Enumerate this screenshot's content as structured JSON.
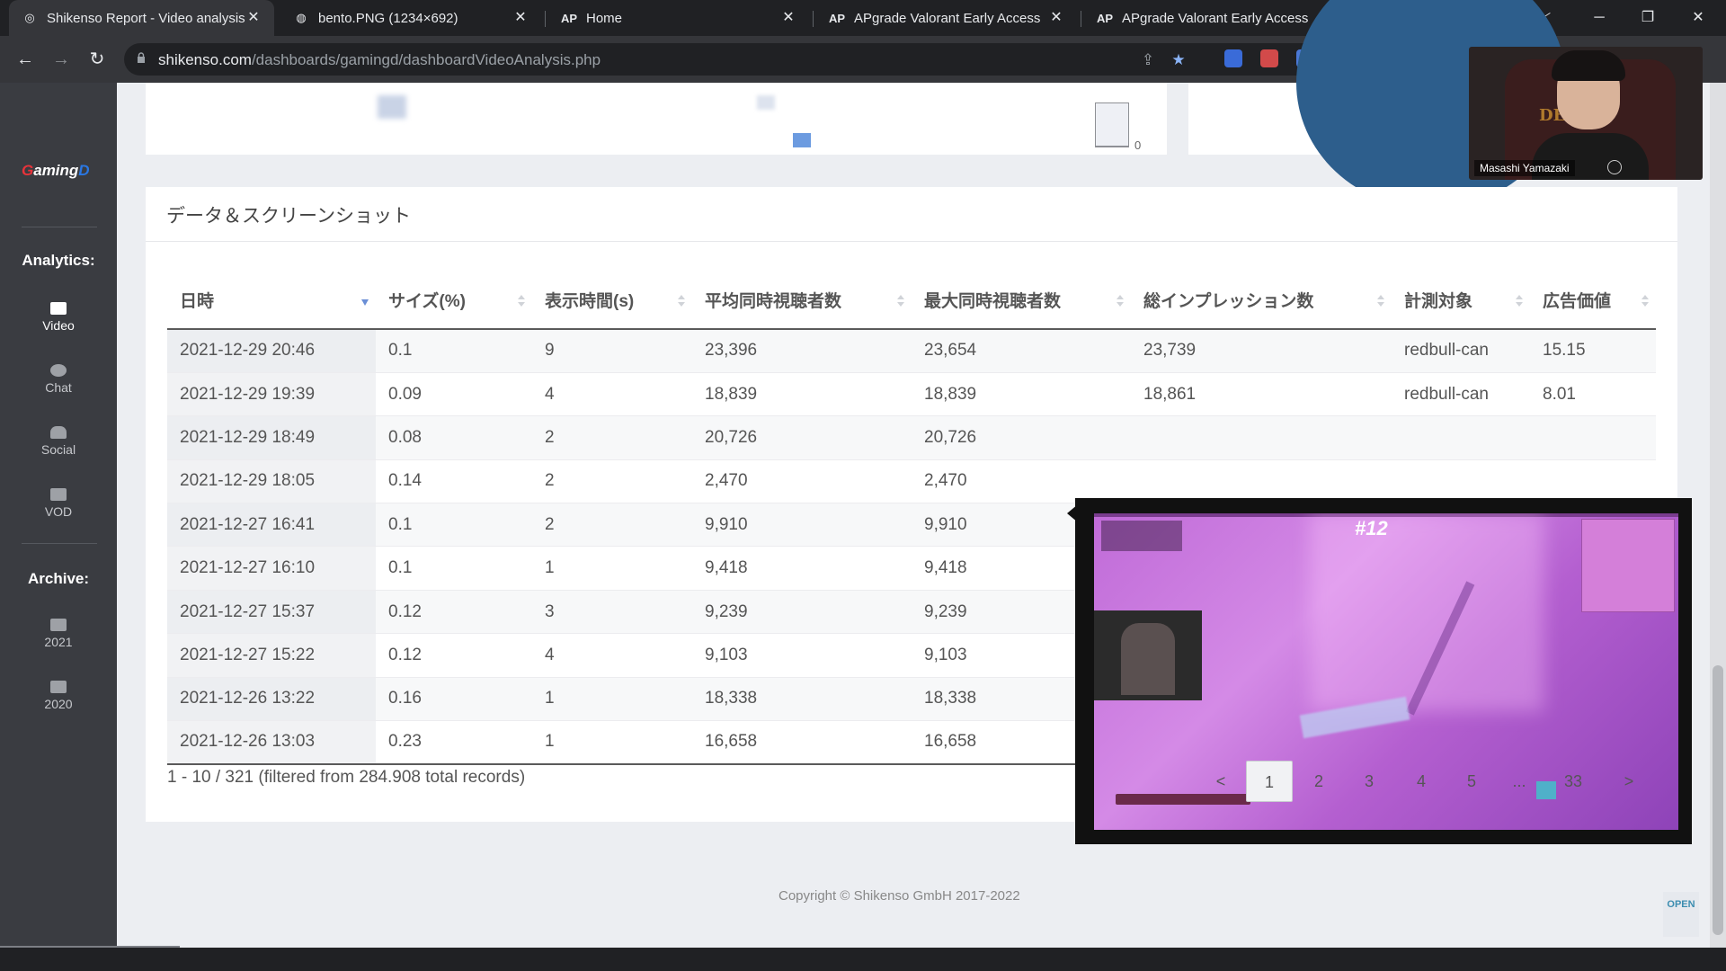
{
  "browser": {
    "tabs": [
      {
        "label": "Shikenso Report - Video analysis",
        "icon": "shikenso-favicon",
        "active": true
      },
      {
        "label": "bento.PNG (1234×692)",
        "icon": "globe-icon",
        "active": false
      },
      {
        "label": "Home",
        "icon": "AP",
        "active": false
      },
      {
        "label": "APgrade Valorant Early Access",
        "icon": "AP",
        "active": false
      },
      {
        "label": "APgrade Valorant Early Access",
        "icon": "AP",
        "active": false
      }
    ],
    "url_host": "shikenso.com",
    "url_path": "/dashboards/gamingd/dashboardVideoAnalysis.php"
  },
  "webcam": {
    "name": "Masashi Yamazaki",
    "chair_logo": "DE TOR"
  },
  "sidebar": {
    "brand_prefix": "G",
    "brand_main": "aming",
    "brand_suffix": "D",
    "analytics_heading": "Analytics:",
    "analytics_items": [
      "Video",
      "Chat",
      "Social",
      "VOD"
    ],
    "archive_heading": "Archive:",
    "archive_items": [
      "2021",
      "2020"
    ]
  },
  "top": {
    "bar_value": "0"
  },
  "section": {
    "title": "データ＆スクリーンショット",
    "columns": [
      "日時",
      "サイズ(%)",
      "表示時間(s)",
      "平均同時視聴者数",
      "最大同時視聴者数",
      "総インプレッション数",
      "計測対象",
      "広告価値"
    ],
    "rows": [
      [
        "2021-12-29 20:46",
        "0.1",
        "9",
        "23,396",
        "23,654",
        "23,739",
        "redbull-can",
        "15.15"
      ],
      [
        "2021-12-29 19:39",
        "0.09",
        "4",
        "18,839",
        "18,839",
        "18,861",
        "redbull-can",
        "8.01"
      ],
      [
        "2021-12-29 18:49",
        "0.08",
        "2",
        "20,726",
        "20,726",
        "",
        "",
        ""
      ],
      [
        "2021-12-29 18:05",
        "0.14",
        "2",
        "2,470",
        "2,470",
        "",
        "",
        ""
      ],
      [
        "2021-12-27 16:41",
        "0.1",
        "2",
        "9,910",
        "9,910",
        "",
        "",
        ""
      ],
      [
        "2021-12-27 16:10",
        "0.1",
        "1",
        "9,418",
        "9,418",
        "",
        "",
        ""
      ],
      [
        "2021-12-27 15:37",
        "0.12",
        "3",
        "9,239",
        "9,239",
        "",
        "",
        ""
      ],
      [
        "2021-12-27 15:22",
        "0.12",
        "4",
        "9,103",
        "9,103",
        "",
        "",
        ""
      ],
      [
        "2021-12-26 13:22",
        "0.16",
        "1",
        "18,338",
        "18,338",
        "",
        "",
        ""
      ],
      [
        "2021-12-26 13:03",
        "0.23",
        "1",
        "16,658",
        "16,658",
        "",
        "",
        ""
      ]
    ],
    "info": "1 - 10 / 321 (filtered from 284.908 total records)",
    "pagination": [
      "<",
      "1",
      "2",
      "3",
      "4",
      "5",
      "...",
      "33",
      ">"
    ],
    "current_page": "1"
  },
  "screenshot_popup": {
    "score_text": "#12"
  },
  "footer": {
    "copyright": "Copyright © Shikenso GmbH 2017-2022",
    "open_badge": "OPEN"
  }
}
